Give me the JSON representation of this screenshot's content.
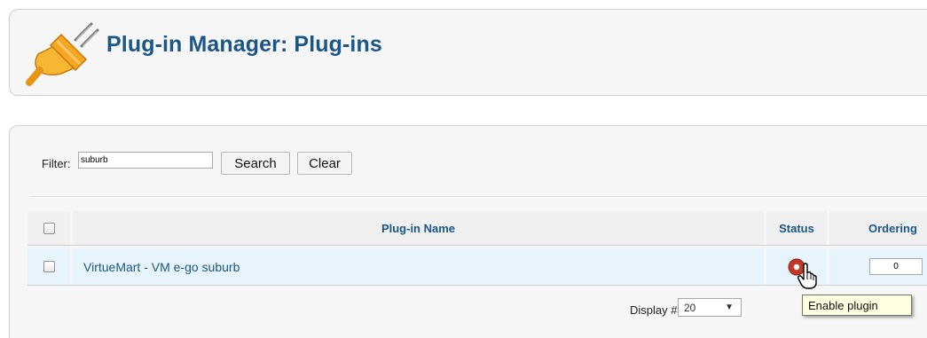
{
  "header": {
    "title": "Plug-in Manager: Plug-ins",
    "icon": "plug-icon"
  },
  "filter": {
    "label": "Filter:",
    "value": "suburb",
    "search_label": "Search",
    "clear_label": "Clear"
  },
  "table": {
    "columns": {
      "name": "Plug-in Name",
      "status": "Status",
      "ordering": "Ordering"
    },
    "rows": [
      {
        "name": "VirtueMart - VM e-go suburb",
        "status": "disabled",
        "ordering": "0"
      }
    ]
  },
  "pagination": {
    "display_label": "Display #",
    "display_value": "20"
  },
  "tooltip": {
    "text": "Enable plugin"
  },
  "colors": {
    "title": "#1b5687",
    "status_disabled": "#c0392b",
    "row_highlight": "#e8f4fb"
  }
}
